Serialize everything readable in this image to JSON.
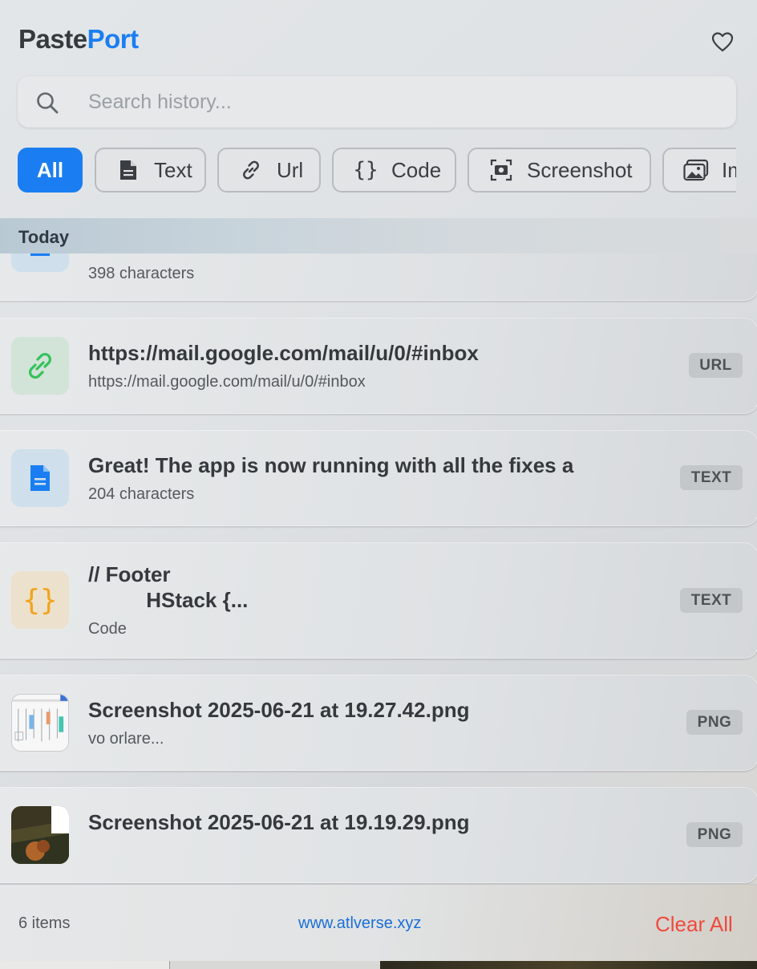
{
  "app": {
    "title_part1": "Paste",
    "title_part2": "Port"
  },
  "header": {
    "favorite_icon": "heart-outline-icon"
  },
  "search": {
    "placeholder": "Search history...",
    "icon": "magnifier-icon"
  },
  "filters": [
    {
      "label": "All",
      "active": true,
      "icon": ""
    },
    {
      "label": "Text",
      "active": false,
      "icon": "document-icon"
    },
    {
      "label": "Url",
      "active": false,
      "icon": "link-icon"
    },
    {
      "label": "Code",
      "active": false,
      "icon": "braces-icon"
    },
    {
      "label": "Screenshot",
      "active": false,
      "icon": "camera-viewfinder-icon"
    },
    {
      "label": "Im",
      "active": false,
      "icon": "photos-icon"
    }
  ],
  "list": {
    "section": "Today",
    "items": [
      {
        "title": "",
        "subtitle": "398 characters",
        "badge": "",
        "icon": "document-icon"
      },
      {
        "title": "https://mail.google.com/mail/u/0/#inbox",
        "subtitle": "https://mail.google.com/mail/u/0/#inbox",
        "badge": "URL",
        "icon": "link-icon"
      },
      {
        "title": "Great! The app is now running with all the fixes a",
        "subtitle": "204 characters",
        "badge": "TEXT",
        "icon": "document-icon"
      },
      {
        "title": "// Footer\n          HStack {...",
        "subtitle": "Code",
        "badge": "TEXT",
        "icon": "braces-icon"
      },
      {
        "title": "Screenshot 2025-06-21 at 19.27.42.png",
        "subtitle": "vo orlare...",
        "badge": "PNG",
        "icon": "image-thumbnail"
      },
      {
        "title": "Screenshot 2025-06-21 at 19.19.29.png",
        "subtitle": "",
        "badge": "PNG",
        "icon": "image-thumbnail"
      }
    ]
  },
  "footer": {
    "count": "6 items",
    "link": "www.atlverse.xyz",
    "clear": "Clear All"
  },
  "colors": {
    "accent": "#1a7ef2",
    "danger": "#f04a3c",
    "link": "#1a6fd6"
  }
}
